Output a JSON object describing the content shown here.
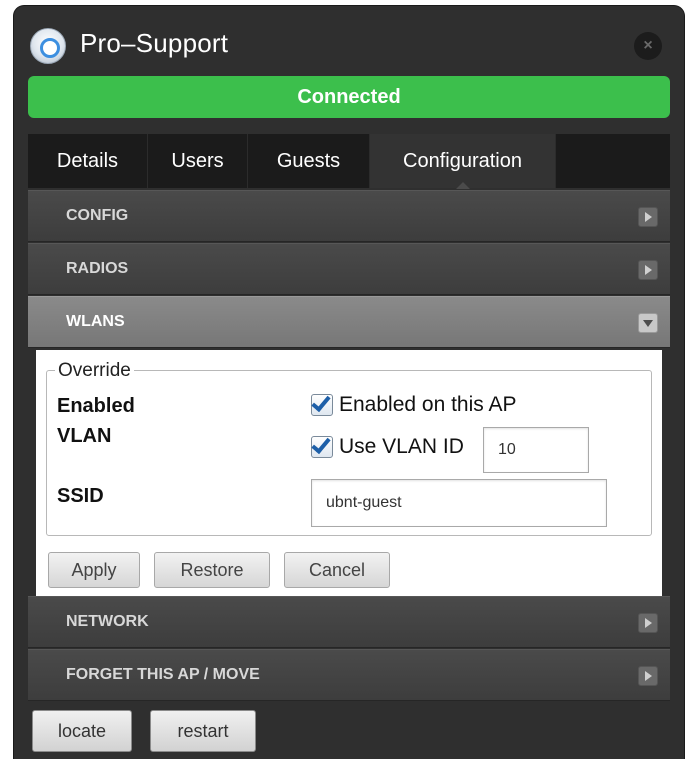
{
  "window": {
    "title": "Pro–Support",
    "icon": "access-point-icon",
    "close_icon": "close-icon",
    "close_symbol": "×"
  },
  "status": {
    "text": "Connected",
    "color": "#3cbf4c"
  },
  "tabs": [
    {
      "label": "Details",
      "active": false
    },
    {
      "label": "Users",
      "active": false
    },
    {
      "label": "Guests",
      "active": false
    },
    {
      "label": "Configuration",
      "active": true
    }
  ],
  "sections": {
    "config": {
      "label": "CONFIG",
      "expanded": false
    },
    "radios": {
      "label": "RADIOS",
      "expanded": false
    },
    "wlans": {
      "label": "WLANS",
      "expanded": true
    },
    "network": {
      "label": "NETWORK",
      "expanded": false
    },
    "forget": {
      "label": "FORGET THIS AP / MOVE",
      "expanded": false
    }
  },
  "wlan_override": {
    "legend": "Override",
    "enabled_label": "Enabled",
    "enabled_checkbox_label": "Enabled on this AP",
    "enabled_checked": true,
    "vlan_label": "VLAN",
    "vlan_checkbox_label": "Use VLAN ID",
    "vlan_checked": true,
    "vlan_id_value": "10",
    "ssid_label": "SSID",
    "ssid_value": "ubnt-guest",
    "apply_label": "Apply",
    "restore_label": "Restore",
    "cancel_label": "Cancel"
  },
  "footer": {
    "locate_label": "locate",
    "restart_label": "restart"
  }
}
